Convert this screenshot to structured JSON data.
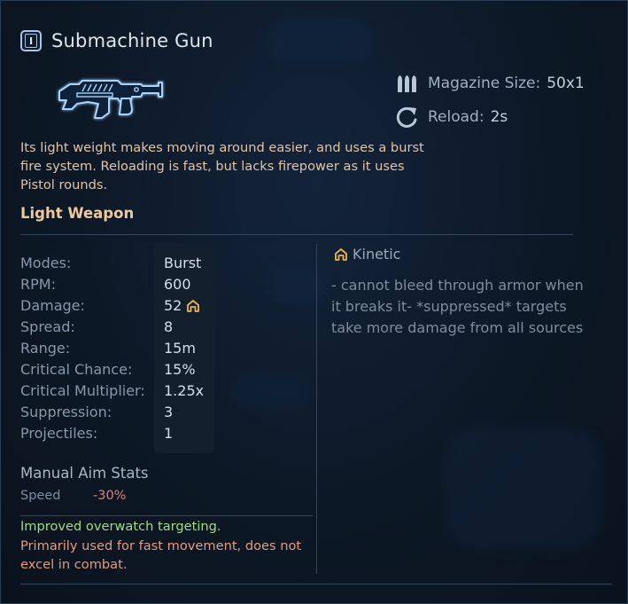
{
  "weapon": {
    "tier_icon": "tier-one-icon",
    "tier_numeral": "I",
    "name": "Submachine Gun",
    "image_icon": "submachine-gun-icon",
    "description": "Its light weight makes moving around easier, and uses a burst fire system. Reloading is fast, but lacks firepower as it uses Pistol rounds.",
    "class": "Light Weapon"
  },
  "top_stats": {
    "magazine": {
      "icon": "ammo-icon",
      "label": "Magazine Size:",
      "value": "50x1"
    },
    "reload": {
      "icon": "reload-icon",
      "label": "Reload:",
      "value": "2s"
    }
  },
  "stats": [
    {
      "key": "Modes:",
      "value": "Burst"
    },
    {
      "key": "RPM:",
      "value": "600"
    },
    {
      "key": "Damage:",
      "value": "52"
    },
    {
      "key": "Spread:",
      "value": "8"
    },
    {
      "key": "Range:",
      "value": "15m"
    },
    {
      "key": "Critical Chance:",
      "value": "15%"
    },
    {
      "key": "Critical Multiplier:",
      "value": "1.25x"
    },
    {
      "key": "Suppression:",
      "value": "3"
    },
    {
      "key": "Projectiles:",
      "value": "1"
    }
  ],
  "damage_type": {
    "icon": "kinetic-icon",
    "label": "Kinetic",
    "description": "- cannot bleed through armor when it breaks it- *suppressed* targets take more damage from all sources"
  },
  "manual_aim": {
    "title": "Manual Aim Stats",
    "stat_label": "Speed",
    "stat_value": "-30%"
  },
  "notes": {
    "pro": "Improved overwatch targeting.",
    "con": "Primarily used for fast movement, does not excel in combat."
  },
  "colors": {
    "accent_orange": "#f0c89a",
    "description_text": "#e2c4a6",
    "pro_green": "#9fdc86",
    "con_red": "#e39b82",
    "kinetic_gold": "#f2b640",
    "panel_bg": "#0d1826"
  }
}
